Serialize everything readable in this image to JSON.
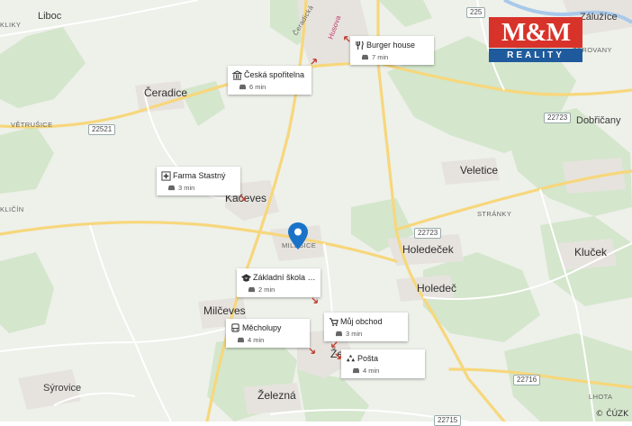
{
  "map": {
    "places": [
      {
        "id": "liboc",
        "label": "Liboc"
      },
      {
        "id": "klicky",
        "label": "KLIKY"
      },
      {
        "id": "ceradice",
        "label": "Čeradice"
      },
      {
        "id": "vetrusice",
        "label": "VĚTRUŠICE"
      },
      {
        "id": "klicin",
        "label": "KLIČÍN"
      },
      {
        "id": "kaceves",
        "label": "Kačeves"
      },
      {
        "id": "milesice",
        "label": "MILEŠICE"
      },
      {
        "id": "milceves",
        "label": "Milčeves"
      },
      {
        "id": "syrovice",
        "label": "Sýrovice"
      },
      {
        "id": "zelezna",
        "label": "Železná"
      },
      {
        "id": "zaluzice",
        "label": "Záluží­ce"
      },
      {
        "id": "dobricany",
        "label": "Dobřičany"
      },
      {
        "id": "veletice",
        "label": "Veletice"
      },
      {
        "id": "stranky",
        "label": "STRÁNKY"
      },
      {
        "id": "holedecek",
        "label": "Holedeček"
      },
      {
        "id": "holedec",
        "label": "Holedeč"
      },
      {
        "id": "klucek",
        "label": "Kluček"
      },
      {
        "id": "lhota",
        "label": "LHOTA"
      },
      {
        "id": "ceradicka",
        "label": "Čeradická"
      },
      {
        "id": "husova",
        "label": "Husova"
      },
      {
        "id": "zerovany",
        "label": "ŽEROVANY"
      },
      {
        "id": "zech",
        "label": "Žech"
      }
    ],
    "roads": [
      "225",
      "22723",
      "22521",
      "22723",
      "22716",
      "22715"
    ],
    "pois": [
      {
        "id": "burger",
        "name": "Burger house",
        "time": "7 min",
        "icon": "fork-knife-icon"
      },
      {
        "id": "sporitelna",
        "name": "Česká spořitelna",
        "time": "6 min",
        "icon": "bank-icon"
      },
      {
        "id": "farma",
        "name": "Farma Stastný",
        "time": "3 min",
        "icon": "medical-cross-icon"
      },
      {
        "id": "skola",
        "name": "Základní škola M...",
        "time": "2 min",
        "icon": "school-cap-icon"
      },
      {
        "id": "obchod",
        "name": "Můj obchod",
        "time": "3 min",
        "icon": "cart-icon"
      },
      {
        "id": "mecholupy",
        "name": "Měcholupy",
        "time": "4 min",
        "icon": "bus-icon"
      },
      {
        "id": "posta",
        "name": "Pošta",
        "time": "4 min",
        "icon": "post-icon"
      }
    ]
  },
  "logo": {
    "top": "M&M",
    "bottom": "REALITY"
  },
  "copyright": "© ČÚZK",
  "colors": {
    "forest": "#d3e6cb",
    "road": "#f6d67a",
    "logo_red": "#d8332a",
    "logo_blue": "#1f5b9c",
    "pin": "#1a73c8"
  }
}
